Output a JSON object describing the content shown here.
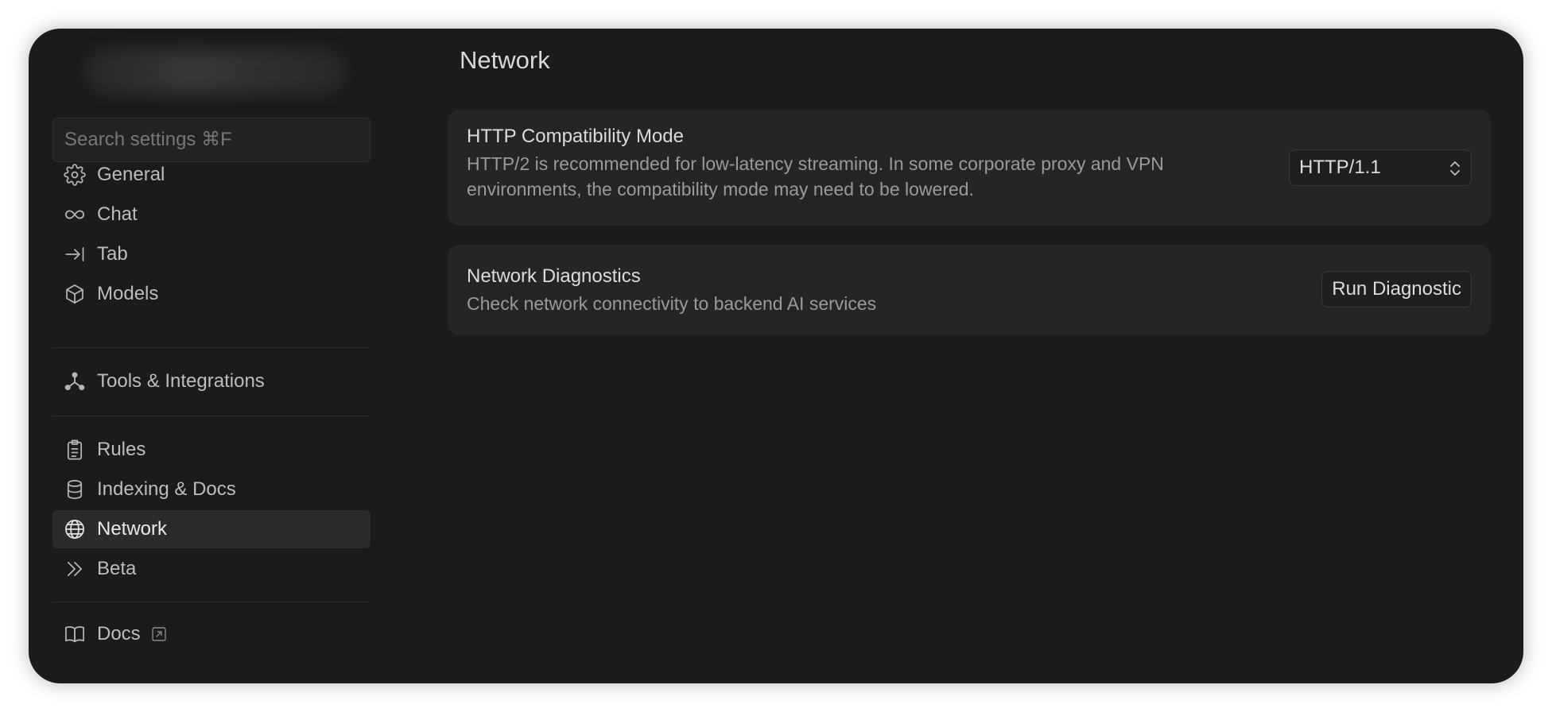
{
  "sidebar": {
    "search_placeholder": "Search settings ⌘F",
    "groups": [
      [
        {
          "label": "General",
          "icon": "gear-icon"
        },
        {
          "label": "Chat",
          "icon": "infinity-icon"
        },
        {
          "label": "Tab",
          "icon": "arrow-to-line-icon"
        },
        {
          "label": "Models",
          "icon": "cube-icon"
        }
      ],
      [
        {
          "label": "Tools & Integrations",
          "icon": "nodes-icon"
        }
      ],
      [
        {
          "label": "Rules",
          "icon": "clipboard-icon"
        },
        {
          "label": "Indexing & Docs",
          "icon": "database-icon"
        },
        {
          "label": "Network",
          "icon": "globe-icon",
          "active": true
        },
        {
          "label": "Beta",
          "icon": "double-chevron-icon"
        }
      ],
      [
        {
          "label": "Docs",
          "icon": "book-icon",
          "external": true
        }
      ]
    ]
  },
  "main": {
    "title": "Network",
    "http_card": {
      "title": "HTTP Compatibility Mode",
      "description_line1": "HTTP/2 is recommended for low-latency streaming. In some corporate proxy and VPN",
      "description_line2": "environments, the compatibility mode may need to be lowered.",
      "select_value": "HTTP/1.1"
    },
    "diagnostics_card": {
      "title": "Network Diagnostics",
      "description": "Check network connectivity to backend AI services",
      "button_label": "Run Diagnostic"
    }
  },
  "colors": {
    "window_bg": "#1b1b1b",
    "card_bg": "#252525",
    "active_item_bg": "#2b2b2b",
    "text_primary": "#dcdcdc",
    "text_secondary": "#9a9a9a"
  }
}
